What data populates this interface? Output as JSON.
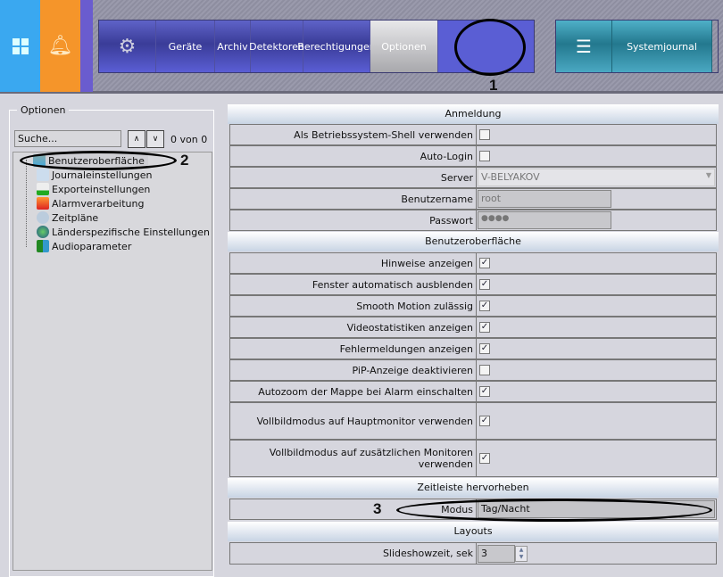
{
  "topbar": {
    "nav": [
      "Geräte",
      "Archiv",
      "Detektoren",
      "Berechtigungen",
      "Optionen"
    ],
    "active": "Optionen",
    "journal": "Systemjournal",
    "colors": {
      "tile1": "#3aa8f0",
      "tile2": "#f5952a",
      "tile3": "#6a5ccf"
    }
  },
  "sidebar": {
    "legend": "Optionen",
    "search_placeholder": "Suche...",
    "count": "0 von 0",
    "items": [
      "Benutzeroberfläche",
      "Journaleinstellungen",
      "Exporteinstellungen",
      "Alarmverarbeitung",
      "Zeitpläne",
      "Länderspezifische Einstellungen",
      "Audioparameter"
    ]
  },
  "annotations": [
    "1",
    "2",
    "3"
  ],
  "sections": {
    "anmeldung": {
      "title": "Anmeldung",
      "rows": [
        {
          "label": "Als Betriebssystem-Shell verwenden",
          "checked": false
        },
        {
          "label": "Auto-Login",
          "checked": false
        },
        {
          "label": "Server",
          "value": "V-BELYAKOV"
        },
        {
          "label": "Benutzername",
          "value": "root"
        },
        {
          "label": "Passwort",
          "value": "●●●●"
        }
      ]
    },
    "ui": {
      "title": "Benutzeroberfläche",
      "rows": [
        {
          "label": "Hinweise anzeigen",
          "checked": true
        },
        {
          "label": "Fenster automatisch ausblenden",
          "checked": true
        },
        {
          "label": "Smooth Motion zulässig",
          "checked": true
        },
        {
          "label": "Videostatistiken anzeigen",
          "checked": true
        },
        {
          "label": "Fehlermeldungen anzeigen",
          "checked": true
        },
        {
          "label": "PiP-Anzeige deaktivieren",
          "checked": false
        },
        {
          "label": "Autozoom der Mappe bei Alarm einschalten",
          "checked": true
        },
        {
          "label": "Vollbildmodus auf Hauptmonitor verwenden",
          "checked": true
        },
        {
          "label": "Vollbildmodus auf zusätzlichen Monitoren verwenden",
          "checked": true
        }
      ]
    },
    "timeline": {
      "title": "Zeitleiste hervorheben",
      "rows": [
        {
          "label": "Modus",
          "value": "Tag/Nacht"
        }
      ]
    },
    "layouts": {
      "title": "Layouts",
      "rows": [
        {
          "label": "Slideshowzeit, sek",
          "value": "3"
        }
      ]
    }
  }
}
